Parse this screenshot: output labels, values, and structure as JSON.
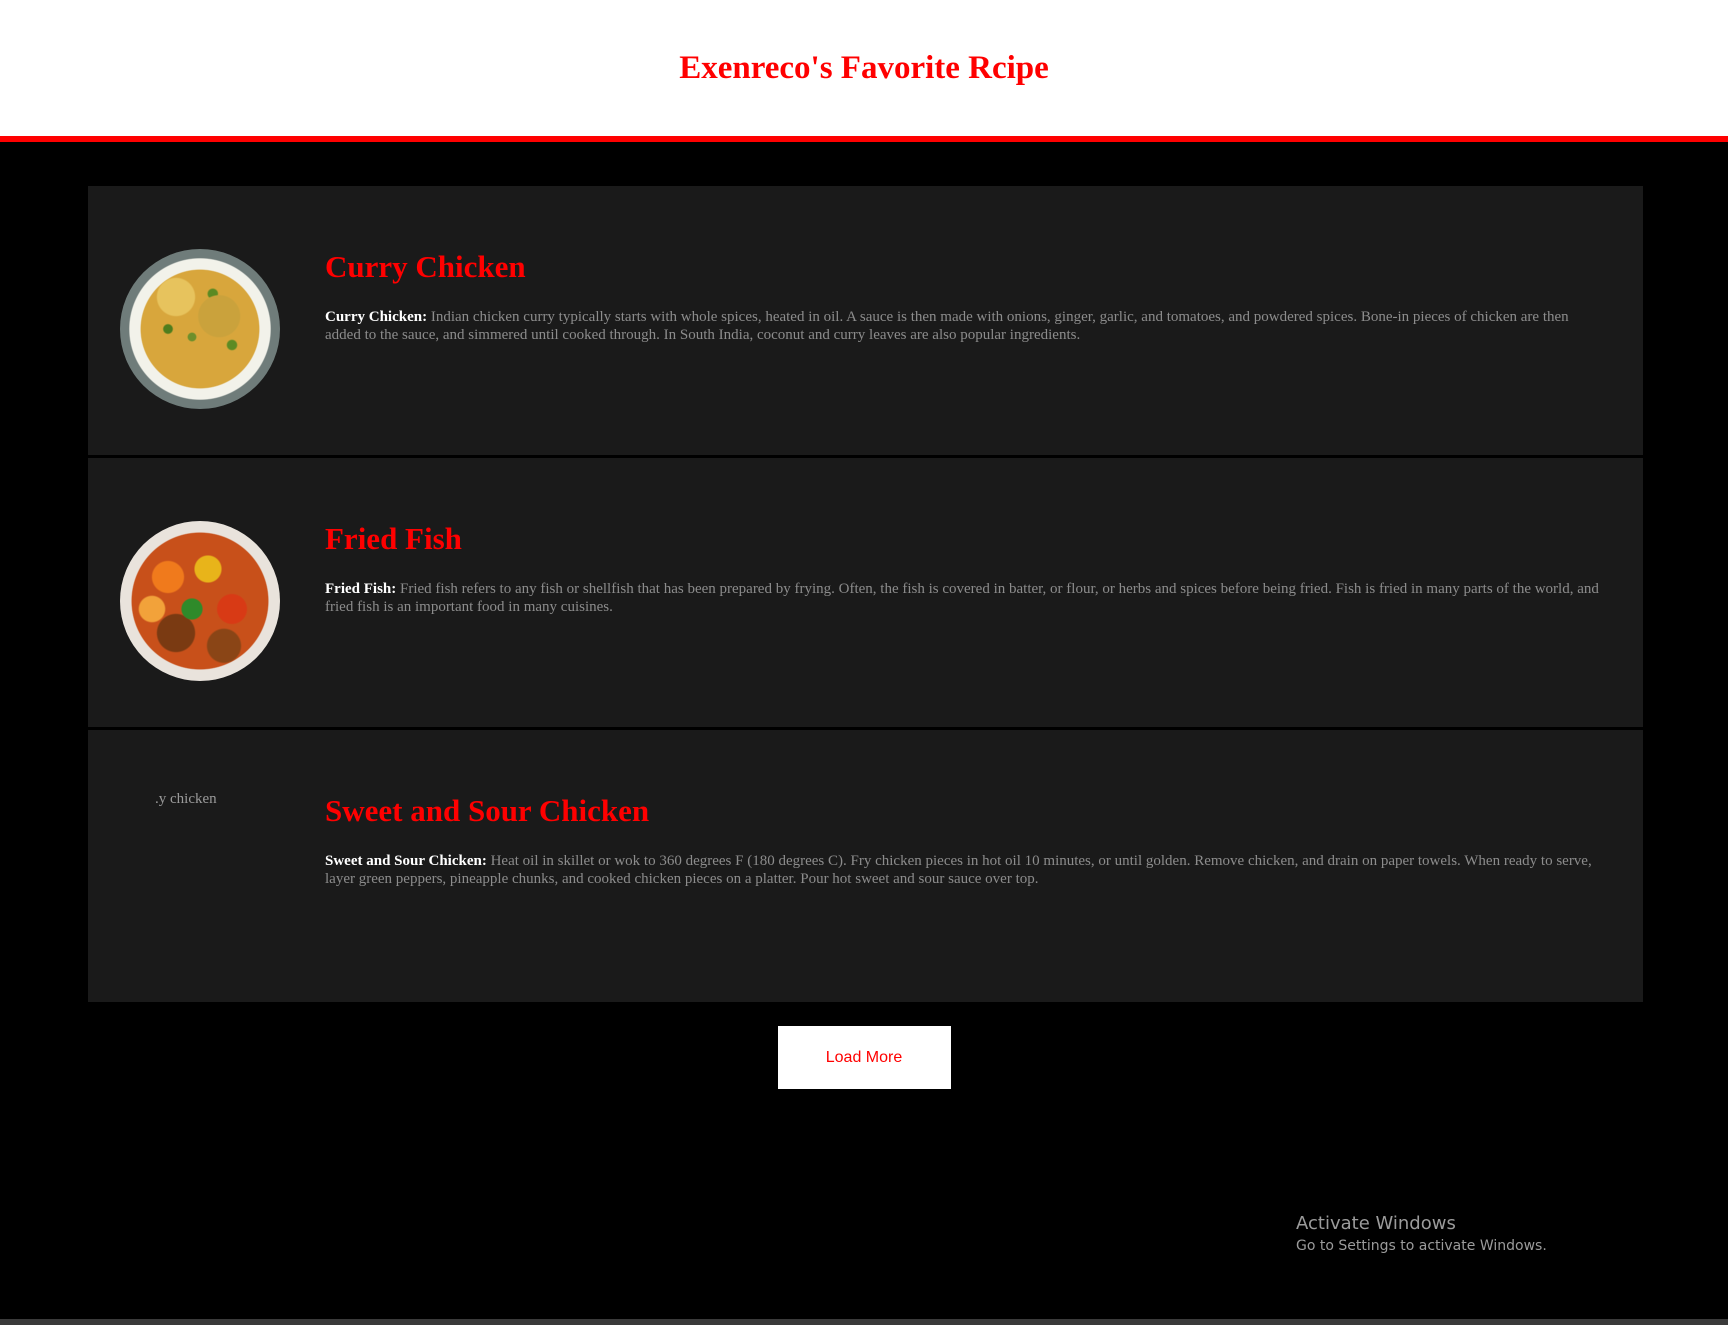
{
  "header": {
    "title": "Exenreco's Favorite Rcipe"
  },
  "recipes": [
    {
      "title": "Curry Chicken",
      "desc_label": "Curry Chicken:",
      "desc_text": " Indian chicken curry typically starts with whole spices, heated in oil. A sauce is then made with onions, ginger, garlic, and tomatoes, and powdered spices. Bone-in pieces of chicken are then added to the sauce, and simmered until cooked through. In South India, coconut and curry leaves are also popular ingredients.",
      "image": "curry-chicken-photo"
    },
    {
      "title": "Fried Fish",
      "desc_label": "Fried Fish:",
      "desc_text": " Fried fish refers to any fish or shellfish that has been prepared by frying. Often, the fish is covered in batter, or flour, or herbs and spices before being fried. Fish is fried in many parts of the world, and fried fish is an important food in many cuisines.",
      "image": "fried-fish-photo"
    },
    {
      "title": "Sweet and Sour Chicken",
      "desc_label": "Sweet and Sour Chicken:",
      "desc_text": " Heat oil in skillet or wok to 360 degrees F (180 degrees C). Fry chicken pieces in hot oil 10 minutes, or until golden. Remove chicken, and drain on paper towels. When ready to serve, layer green peppers, pineapple chunks, and cooked chicken pieces on a platter. Pour hot sweet and sour sauce over top.",
      "image_alt": ".y chicken"
    }
  ],
  "load_more": {
    "label": "Load More"
  },
  "watermark": {
    "title": "Activate Windows",
    "subtitle": "Go to Settings to activate Windows."
  },
  "colors": {
    "accent": "#ff0000",
    "background": "#000000",
    "card": "#1a1a1a",
    "header_bg": "#ffffff"
  }
}
